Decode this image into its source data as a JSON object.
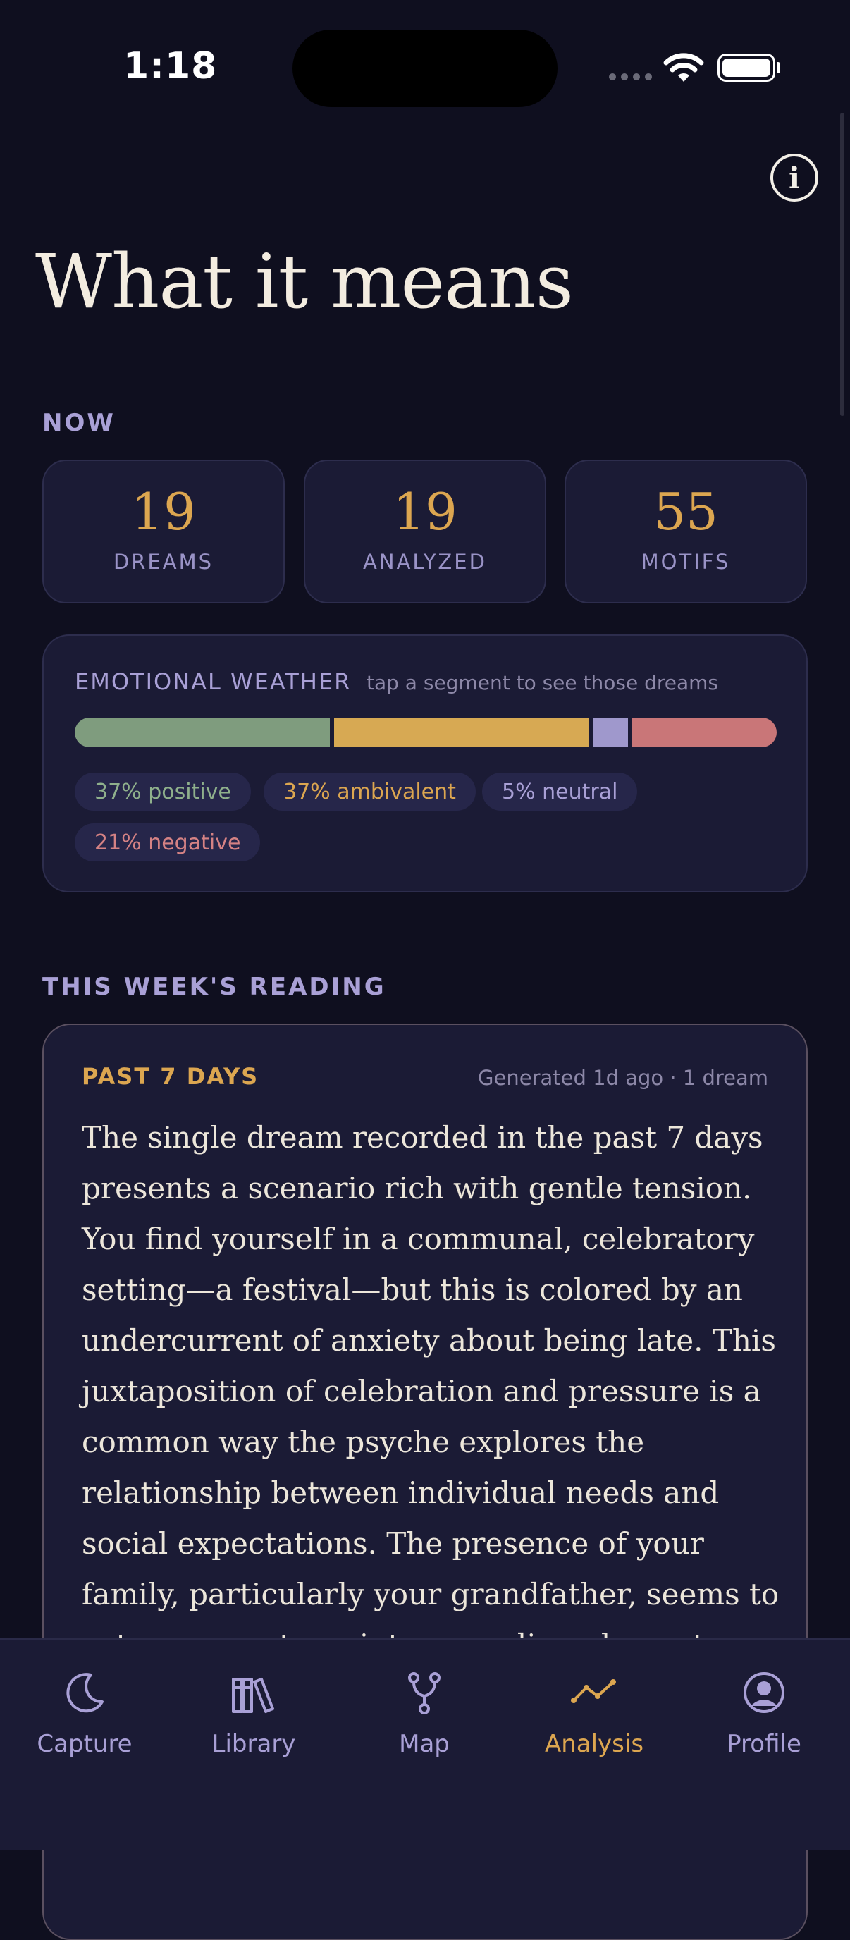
{
  "status_bar": {
    "time": "1:18"
  },
  "header": {
    "title": "What it means"
  },
  "now_section": {
    "label": "NOW",
    "stats": [
      {
        "value": "19",
        "label": "DREAMS"
      },
      {
        "value": "19",
        "label": "ANALYZED"
      },
      {
        "value": "55",
        "label": "MOTIFS"
      }
    ]
  },
  "emotional_weather": {
    "title": "EMOTIONAL WEATHER",
    "hint": "tap a segment to see those dreams",
    "segments": [
      {
        "label": "37% positive",
        "percent": 37,
        "color": "#7f9c7e",
        "text_color": "#8fb08c"
      },
      {
        "label": "37% ambivalent",
        "percent": 37,
        "color": "#d7a953",
        "text_color": "#dca650"
      },
      {
        "label": "5% neutral",
        "percent": 5,
        "color": "#9f98cc",
        "text_color": "#a9a0d6"
      },
      {
        "label": "21% negative",
        "percent": 21,
        "color": "#c97678",
        "text_color": "#d58284"
      }
    ]
  },
  "weekly_reading": {
    "section_label": "THIS WEEK'S READING",
    "range": "PAST 7 DAYS",
    "meta": "Generated 1d ago · 1 dream",
    "text": "The single dream recorded in the past 7 days presents a scenario rich with gentle tension. You find yourself in a communal, celebratory setting—a festival—but this is colored by an undercurrent of anxiety about being late. This juxtaposition of celebration and pressure is a common way the psyche explores the relationship between individual needs and social expectations. The presence of your family, particularly your grandfather, seems to act as a counterpoint, grounding elements within"
  },
  "tab_bar": {
    "tabs": [
      {
        "label": "Capture",
        "icon": "moon-icon",
        "active": false
      },
      {
        "label": "Library",
        "icon": "books-icon",
        "active": false
      },
      {
        "label": "Map",
        "icon": "branch-icon",
        "active": false
      },
      {
        "label": "Analysis",
        "icon": "trend-line-icon",
        "active": true
      },
      {
        "label": "Profile",
        "icon": "user-circle-icon",
        "active": false
      }
    ]
  },
  "colors": {
    "accent": "#dca650",
    "muted": "#a9a0d6",
    "background": "#0f0f1f",
    "card": "#1b1b35"
  }
}
